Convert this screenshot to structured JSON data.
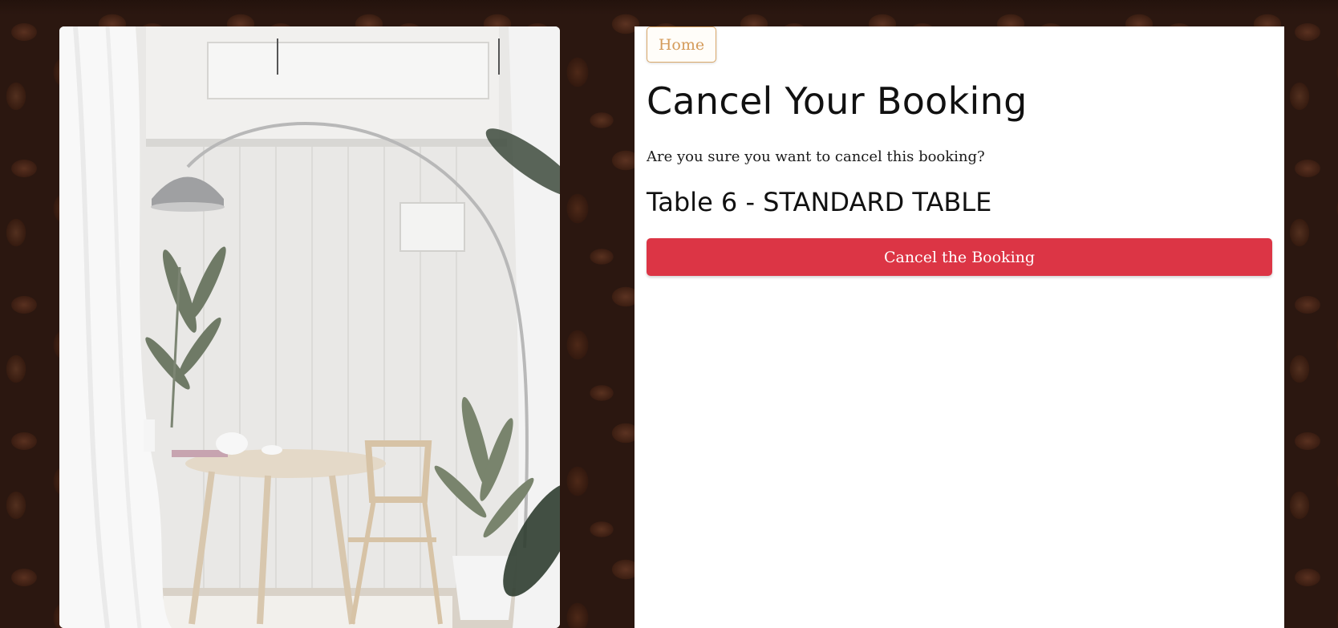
{
  "nav": {
    "home_label": "Home"
  },
  "main": {
    "title": "Cancel Your Booking",
    "confirm_text": "Are you sure you want to cancel this booking?",
    "table_heading": "Table 6 - STANDARD TABLE",
    "cancel_button_label": "Cancel the Booking"
  },
  "colors": {
    "background": "#2b1710",
    "panel": "#ffffff",
    "home_accent": "#d49b5a",
    "danger": "#dc3545"
  },
  "images": {
    "left_photo": "interior-photo",
    "background": "coffee-beans-texture"
  }
}
